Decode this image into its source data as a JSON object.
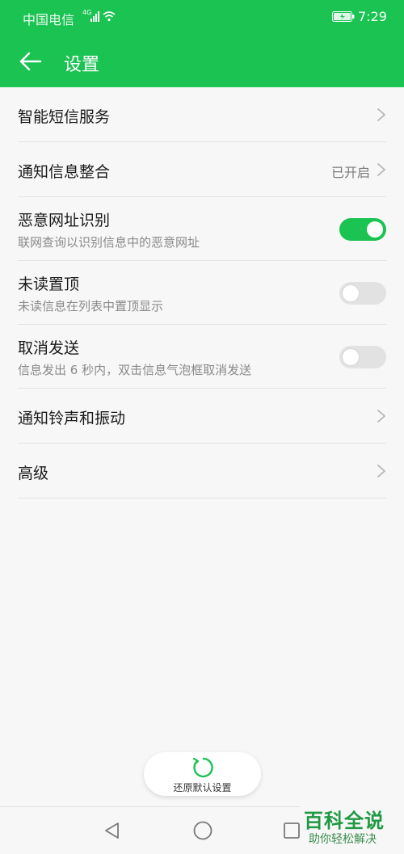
{
  "status_bar": {
    "carrier": "中国电信",
    "network": "4G",
    "time": "7:29"
  },
  "app_bar": {
    "title": "设置",
    "back_icon": "arrow-left-icon"
  },
  "settings": [
    {
      "label": "智能短信服务",
      "type": "link"
    },
    {
      "label": "通知信息整合",
      "type": "link",
      "value": "已开启"
    },
    {
      "label": "恶意网址识别",
      "subtitle": "联网查询以识别信息中的恶意网址",
      "type": "switch",
      "on": true
    },
    {
      "label": "未读置顶",
      "subtitle": "未读信息在列表中置顶显示",
      "type": "switch",
      "on": false
    },
    {
      "label": "取消发送",
      "subtitle": "信息发出 6 秒内，双击信息气泡框取消发送",
      "type": "switch",
      "on": false
    },
    {
      "label": "通知铃声和振动",
      "type": "link"
    },
    {
      "label": "高级",
      "type": "link"
    }
  ],
  "restore_button": {
    "label": "还原默认设置",
    "icon": "restore-icon"
  },
  "navbar": {
    "icons": [
      "nav-back-icon",
      "nav-home-icon",
      "nav-recent-icon"
    ]
  },
  "watermark": {
    "title": "百科全说",
    "subtitle": "助你轻松解决"
  },
  "colors": {
    "accent": "#1bc352",
    "background": "#f7f7f7",
    "divider": "#e3e3e3"
  }
}
